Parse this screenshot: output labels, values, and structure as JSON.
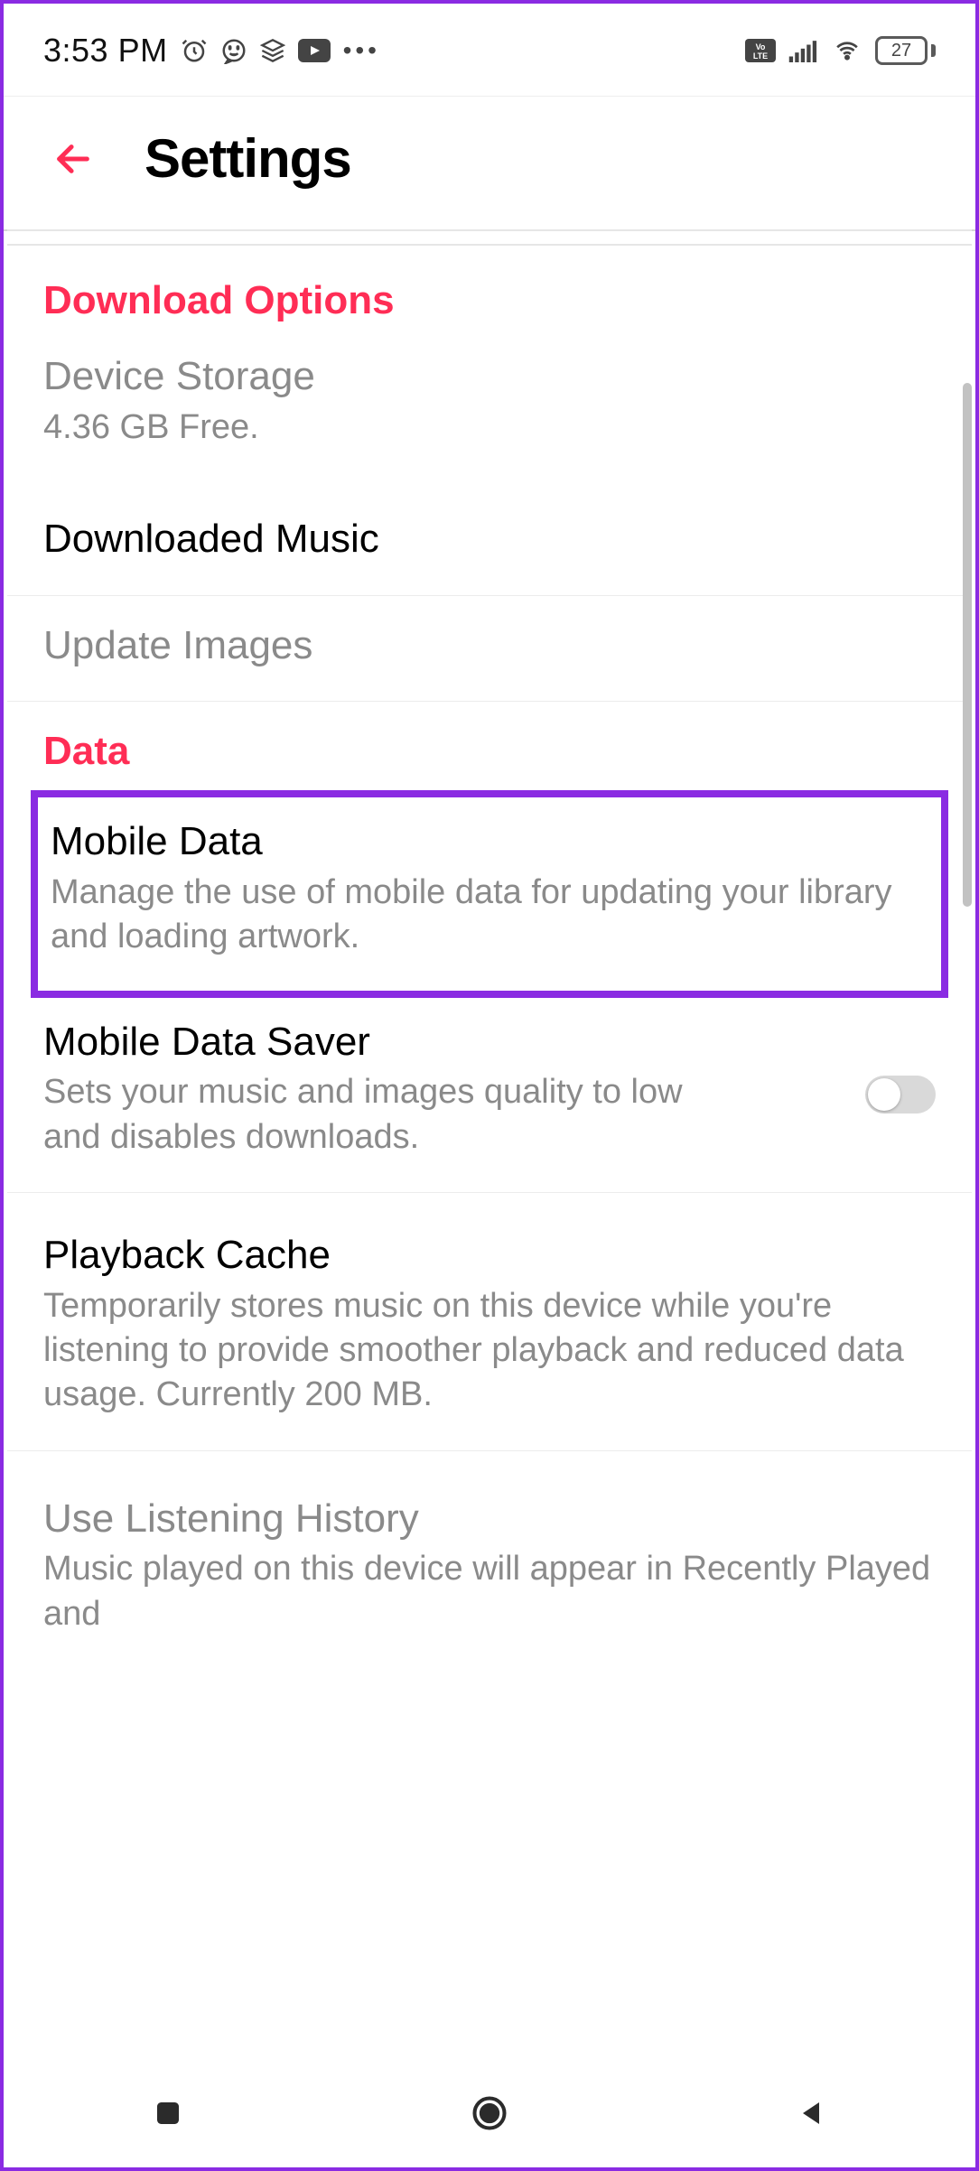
{
  "status": {
    "time": "3:53 PM",
    "battery": "27"
  },
  "header": {
    "title": "Settings"
  },
  "sections": {
    "download": {
      "header": "Download Options",
      "device_storage_title": "Device Storage",
      "device_storage_sub": "4.36 GB Free.",
      "downloaded_music": "Downloaded Music",
      "update_images": "Update Images"
    },
    "data": {
      "header": "Data",
      "mobile_data_title": "Mobile Data",
      "mobile_data_sub": "Manage the use of mobile data for updating your library and loading artwork.",
      "saver_title": "Mobile Data Saver",
      "saver_sub": "Sets your music and images quality to low and disables downloads.",
      "cache_title": "Playback Cache",
      "cache_sub": "Temporarily stores music on this device while you're listening to provide smoother playback and reduced data usage. Currently 200 MB.",
      "history_title": "Use Listening History",
      "history_sub": "Music played on this device will appear in Recently Played and"
    }
  },
  "colors": {
    "accent": "#ff2d55",
    "highlight": "#8A2BE2"
  }
}
